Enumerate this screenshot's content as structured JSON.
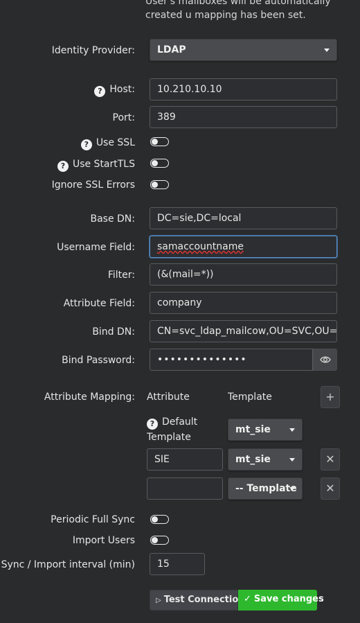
{
  "info_text": "User's mailboxes will be automatically created u mapping has been set.",
  "identity_provider": {
    "label": "Identity Provider:",
    "value": "LDAP"
  },
  "host": {
    "label": "Host:",
    "value": "10.210.10.10"
  },
  "port": {
    "label": "Port:",
    "value": "389"
  },
  "use_ssl": {
    "label": "Use SSL"
  },
  "use_starttls": {
    "label": "Use StartTLS"
  },
  "ignore_ssl_errors": {
    "label": "Ignore SSL Errors"
  },
  "base_dn": {
    "label": "Base DN:",
    "value": "DC=sie,DC=local"
  },
  "username_field": {
    "label": "Username Field:",
    "value": "samaccountname"
  },
  "filter": {
    "label": "Filter:",
    "value": "(&(mail=*))"
  },
  "attribute_field": {
    "label": "Attribute Field:",
    "value": "company"
  },
  "bind_dn": {
    "label": "Bind DN:",
    "value": "CN=svc_ldap_mailcow,OU=SVC,OU=Sta"
  },
  "bind_password": {
    "label": "Bind Password:",
    "value": "••••••••••••••"
  },
  "attribute_mapping": {
    "label": "Attribute Mapping:",
    "col_attribute": "Attribute",
    "col_template": "Template",
    "add_symbol": "+",
    "default_label_1": "Default",
    "default_label_2": "Template",
    "default_template": "mt_sie",
    "rows": [
      {
        "attribute": "SIE",
        "template": "mt_sie",
        "remove_symbol": "✕"
      },
      {
        "attribute": "",
        "template": "-- Template",
        "remove_symbol": "✕"
      }
    ]
  },
  "periodic_full_sync": {
    "label": "Periodic Full Sync"
  },
  "import_users": {
    "label": "Import Users"
  },
  "sync_interval": {
    "label": "Sync / Import interval (min)",
    "value": "15"
  },
  "buttons": {
    "test_connection": "Test Connection",
    "save_changes": "Save changes"
  },
  "icons": {
    "question": "?",
    "eye": "eye-icon",
    "play": "▷",
    "check": "✓"
  },
  "colors": {
    "background": "#2a2b2d",
    "save": "#2eb82e",
    "focus": "#5b8dbf"
  }
}
